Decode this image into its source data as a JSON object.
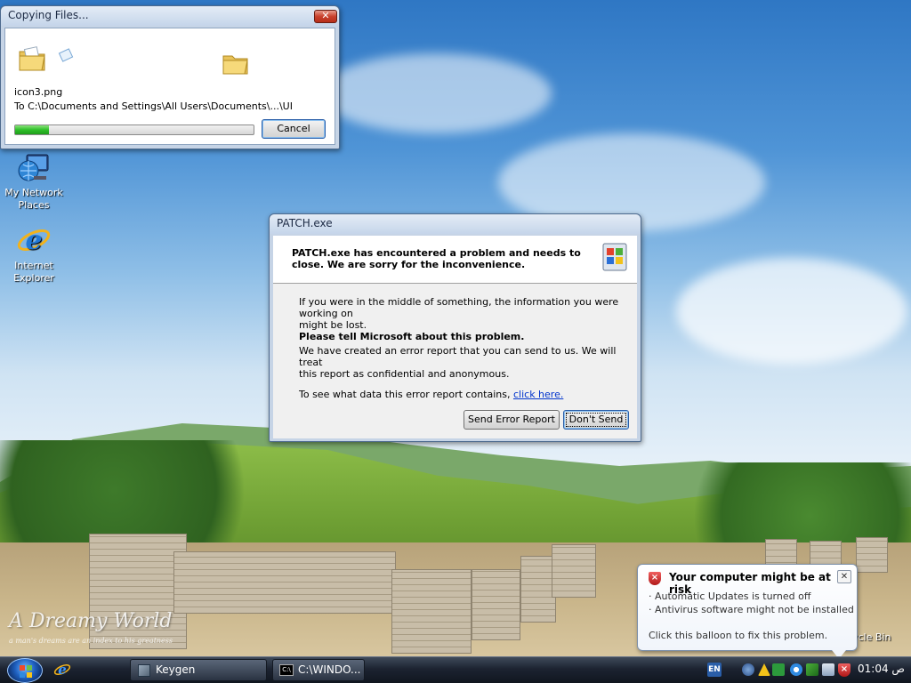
{
  "desktop": {
    "icons": [
      {
        "label_line1": "My Network",
        "label_line2": "Places"
      },
      {
        "label_line1": "Internet",
        "label_line2": "Explorer"
      }
    ],
    "recycle_bin_partial": "ycle Bin",
    "wallpaper_title": "A Dreamy World",
    "wallpaper_tagline": "a man's dreams are an index to his greatness"
  },
  "copy_dialog": {
    "title": "Copying Files...",
    "close_label": "✕",
    "file_name": "icon3.png",
    "destination": "To C:\\Documents and Settings\\All Users\\Documents\\...\\UI",
    "progress_fraction": 0.14,
    "cancel_label": "Cancel"
  },
  "error_dialog": {
    "title": "PATCH.exe",
    "header_line1": "PATCH.exe has encountered a problem and needs to",
    "header_line2": "close.  We are sorry for the inconvenience.",
    "para1_line1": "If you were in the middle of something, the information you were working on",
    "para1_line2": "might be lost.",
    "tell_heading": "Please tell Microsoft about this problem.",
    "para2_line1": "We have created an error report that you can send to us.  We will treat",
    "para2_line2": "this report as confidential and anonymous.",
    "data_prefix": "To see what data this error report contains, ",
    "data_link": "click here.",
    "send_label": "Send Error Report",
    "dont_send_label": "Don't Send"
  },
  "balloon": {
    "title": "Your computer might be at risk",
    "close_label": "✕",
    "line1": "· Automatic Updates is turned off",
    "line2": "· Antivirus software might not be installed",
    "footer": "Click this balloon to fix this problem."
  },
  "taskbar": {
    "buttons": [
      {
        "label": "Keygen"
      },
      {
        "label": "C:\\WINDO..."
      }
    ],
    "language": "EN",
    "clock": "01:04 ص"
  },
  "colors": {
    "progress_green": "#2fbf2a",
    "link_blue": "#0033cc",
    "taskbar_dark": "#1c2331",
    "security_red": "#c0201c"
  }
}
